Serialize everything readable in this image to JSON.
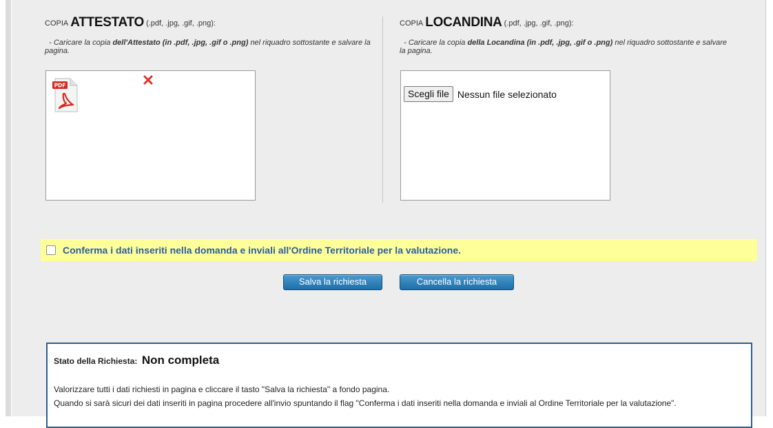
{
  "attestato": {
    "title_prefix": "COPIA",
    "title_main": "ATTESTATO",
    "title_suffix": "(.pdf, .jpg, .gif, .png):",
    "instr_1": "- Caricare la copia",
    "instr_bold": "dell'Attestato (in .pdf, .jpg, .gif o .png)",
    "instr_2": "nel riquadro sottostante e salvare la pagina.",
    "file_icon": "pdf-file-icon",
    "remove_icon": "remove-x-icon"
  },
  "locandina": {
    "title_prefix": "COPIA",
    "title_main": "LOCANDINA",
    "title_suffix": "(.pdf, .jpg, .gif, .png):",
    "instr_1": "- Caricare la copia",
    "instr_bold": "della Locandina (in .pdf, .jpg, .gif o .png)",
    "instr_2": "nel riquadro sottostante e salvare la pagina.",
    "file_button": "Scegli file",
    "file_status": "Nessun file selezionato"
  },
  "confirm": {
    "label": "Conferma i dati inseriti nella domanda e inviali all'Ordine Territoriale per la valutazione.",
    "checked": false,
    "bar_color": "#ffff99"
  },
  "actions": {
    "save": "Salva la richiesta",
    "cancel": "Cancella la richiesta",
    "button_color": "#2a7ab8"
  },
  "status": {
    "label": "Stato della Richiesta:",
    "value": "Non completa",
    "line_1": "Valorizzare tutti i dati richiesti in pagina e cliccare il tasto \"Salva la richiesta\" a fondo pagina.",
    "line_2": "Quando si sarà sicuri dei dati inseriti in pagina procedere all'invio spuntando il flag \"Conferma i dati inseriti nella domanda e inviali al Ordine Territoriale per la valutazione\"."
  }
}
